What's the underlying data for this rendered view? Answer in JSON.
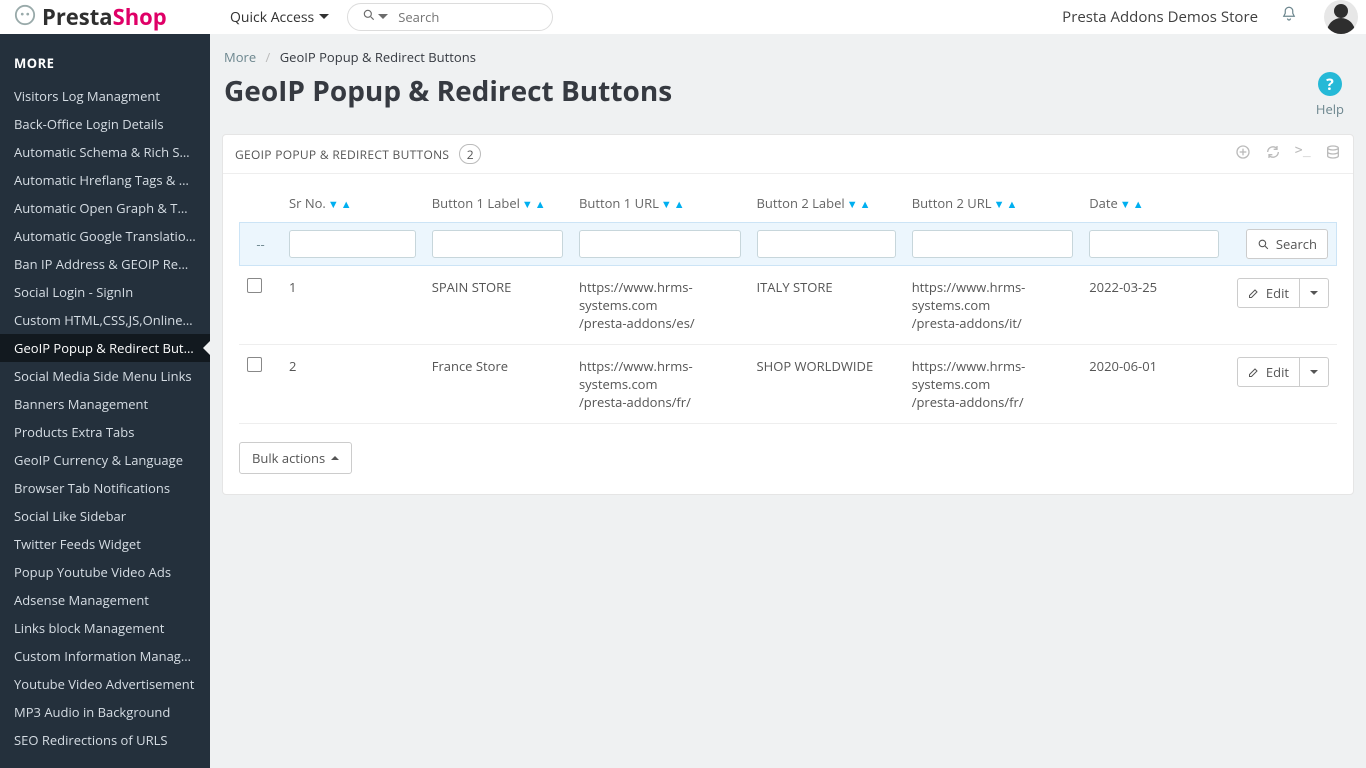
{
  "logo": {
    "brand_part1": "Presta",
    "brand_part2": "Shop"
  },
  "topbar": {
    "quick_access": "Quick Access",
    "search_placeholder": "Search",
    "store_name": "Presta Addons Demos Store"
  },
  "sidebar": {
    "heading": "MORE",
    "items": [
      "Visitors Log Managment",
      "Back-Office Login Details",
      "Automatic Schema & Rich Snip...",
      "Automatic Hreflang Tags & Can...",
      "Automatic Open Graph & Twitt...",
      "Automatic Google Translation ...",
      "Ban IP Address & GEOIP Redirect",
      "Social Login - SignIn",
      "Custom HTML,CSS,JS,Online Ch...",
      "GeoIP Popup & Redirect Buttons",
      "Social Media Side Menu Links",
      "Banners Management",
      "Products Extra Tabs",
      "GeoIP Currency & Language",
      "Browser Tab Notifications",
      "Social Like Sidebar",
      "Twitter Feeds Widget",
      "Popup Youtube Video Ads",
      "Adsense Management",
      "Links block Management",
      "Custom Information Managem...",
      "Youtube Video Advertisement",
      "MP3 Audio in Background",
      "SEO Redirections of URLS"
    ],
    "active_index": 9
  },
  "breadcrumb": {
    "root": "More",
    "current": "GeoIP Popup & Redirect Buttons"
  },
  "page": {
    "title": "GeoIP Popup & Redirect Buttons",
    "help_label": "Help"
  },
  "panel": {
    "title": "GEOIP POPUP & REDIRECT BUTTONS",
    "count": "2",
    "columns": {
      "sr_no": "Sr No.",
      "btn1_label": "Button 1 Label",
      "btn1_url": "Button 1 URL",
      "btn2_label": "Button 2 Label",
      "btn2_url": "Button 2 URL",
      "date": "Date"
    },
    "search_button": "Search",
    "edit_button": "Edit",
    "bulk_actions": "Bulk actions"
  },
  "rows": [
    {
      "sr": "1",
      "b1label": "SPAIN STORE",
      "b1url": "https://www.hrms-systems.com/presta-addons/es/",
      "b2label": "ITALY STORE",
      "b2url": "https://www.hrms-systems.com/presta-addons/it/",
      "date": "2022-03-25"
    },
    {
      "sr": "2",
      "b1label": "France Store",
      "b1url": "https://www.hrms-systems.com/presta-addons/fr/",
      "b2label": "SHOP WORLDWIDE",
      "b2url": "https://www.hrms-systems.com/presta-addons/fr/",
      "date": "2020-06-01"
    }
  ]
}
